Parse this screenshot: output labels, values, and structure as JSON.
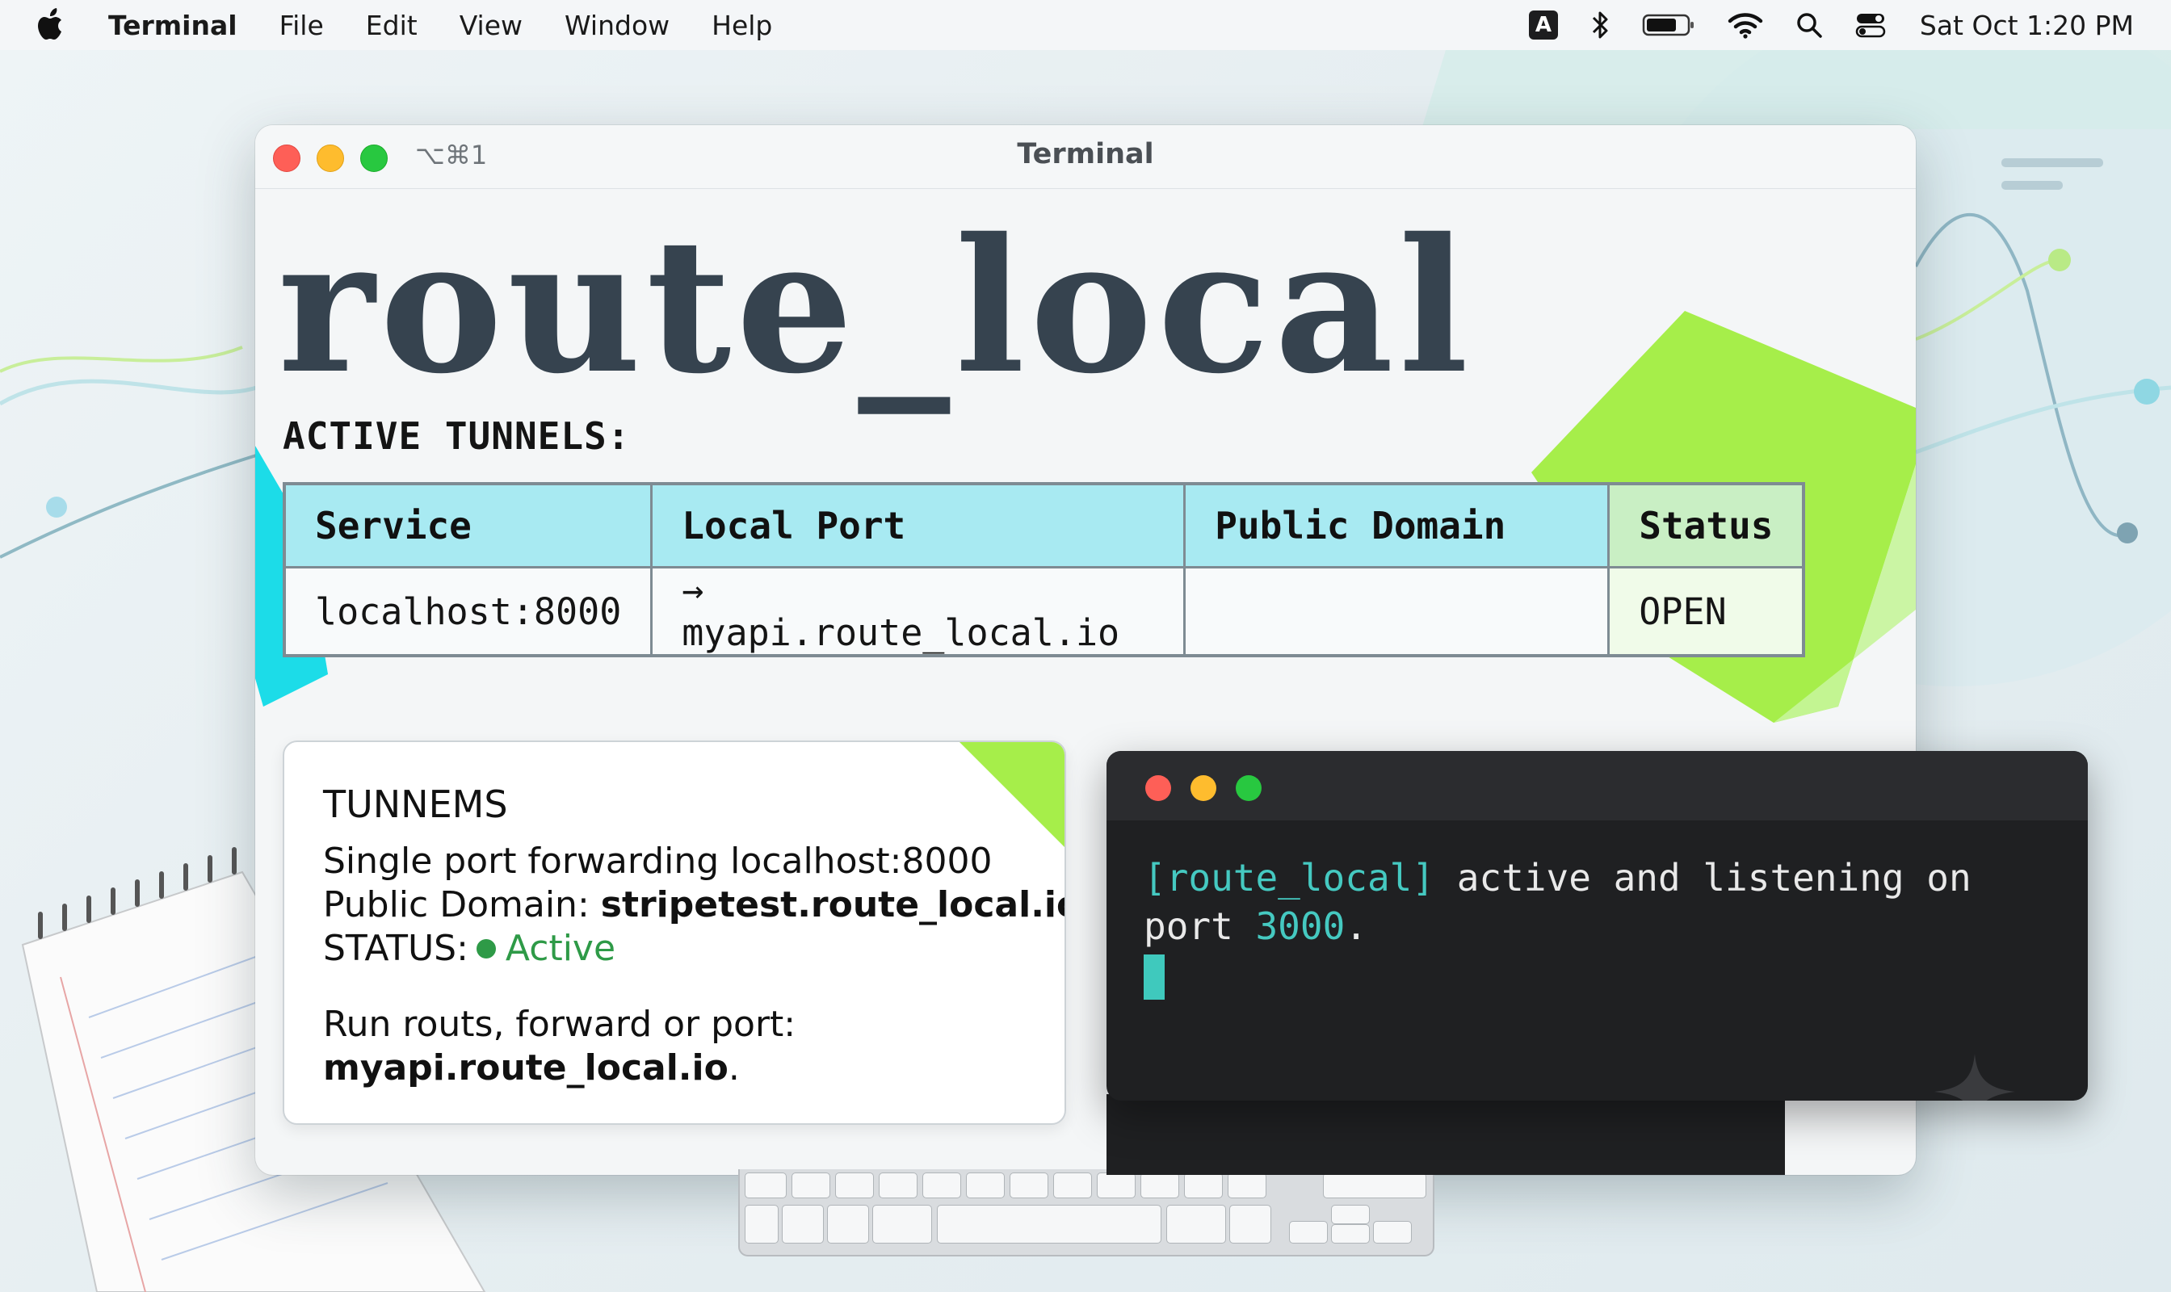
{
  "menubar": {
    "app_name": "Terminal",
    "menus": [
      "File",
      "Edit",
      "View",
      "Window",
      "Help"
    ],
    "input_source": "A",
    "clock": "Sat Oct  1:20 PM"
  },
  "window": {
    "title": "Terminal",
    "shortcut": "⌥⌘1"
  },
  "hero_title": "route_local",
  "section_heading": "ACTIVE TUNNELS:",
  "tunnels_table": {
    "headers": [
      "Service",
      "Local Port",
      "Public Domain",
      "Status"
    ],
    "rows": [
      [
        "localhost:8000",
        "→ myapi.route_local.io",
        "",
        "OPEN"
      ]
    ]
  },
  "info_card": {
    "title": "TUNNEMS",
    "line1": "Single port forwarding localhost:8000",
    "line2_label": "Public Domain: ",
    "line2_value": "stripetest.route_local.io",
    "line3_label": "STATUS:",
    "line3_value": "Active",
    "line4": "Run routs, forward or port:",
    "line5_value": "myapi.route_local.io",
    "line5_suffix": "."
  },
  "dark_terminal": {
    "prompt_tag": "[route_local]",
    "line1_rest": " active and listening on",
    "line2_prefix": "port ",
    "line2_port": "3000",
    "line2_suffix": "."
  },
  "colors": {
    "accent_cyan": "#a8eaf2",
    "accent_green": "#a6ee4a",
    "status_green": "#2e9a47",
    "terminal_cyan": "#45c9c1"
  }
}
